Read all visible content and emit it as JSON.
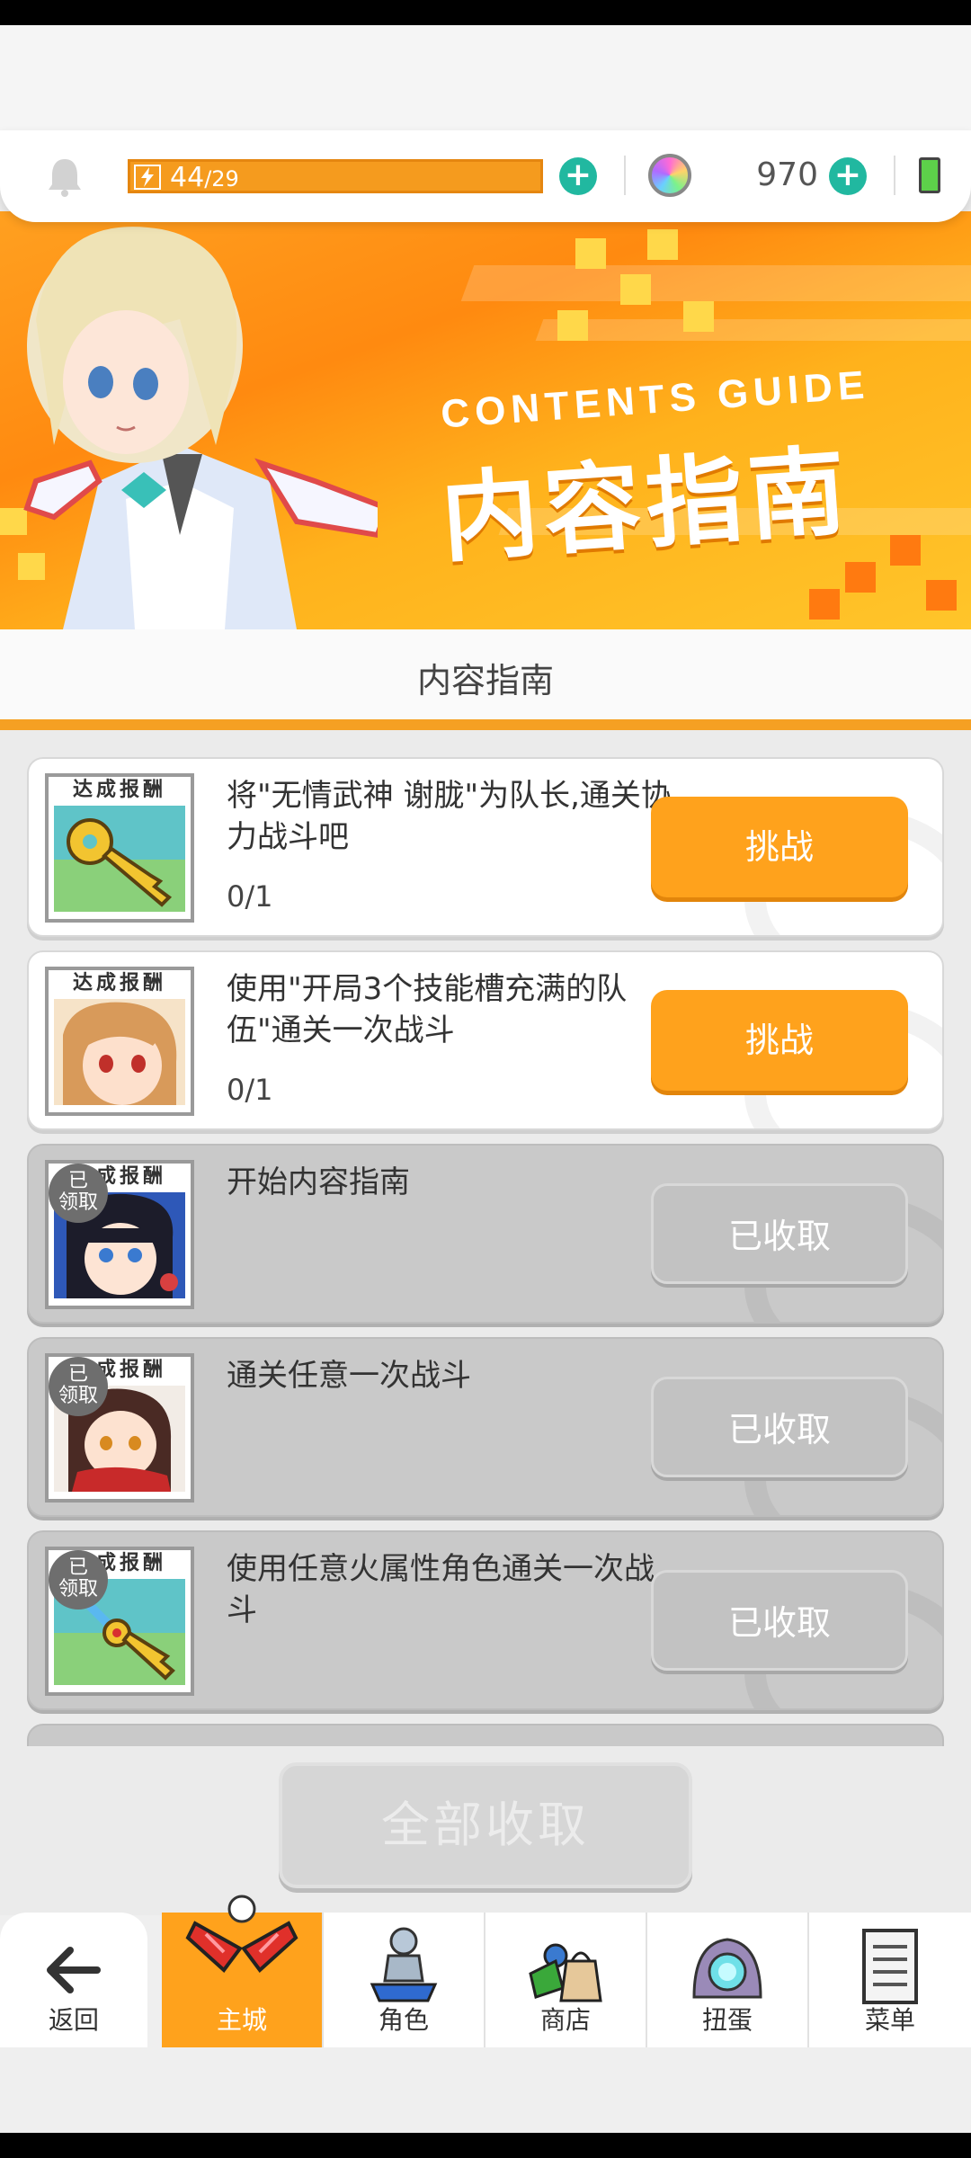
{
  "header": {
    "stamina_current": "44",
    "stamina_max": "/29",
    "gems": "970"
  },
  "banner": {
    "subtitle": "CONTENTS GUIDE",
    "title": "内容指南"
  },
  "section_title": "内容指南",
  "thumb_caption": "达成报酬",
  "claimed_badge": "已\n领取",
  "quests": [
    {
      "text": "将\"无情武神 谢胧\"为队长,通关协力战斗吧",
      "progress": "0/1",
      "button": "挑战",
      "state": "available"
    },
    {
      "text": "使用\"开局3个技能槽充满的队伍\"通关一次战斗",
      "progress": "0/1",
      "button": "挑战",
      "state": "available"
    },
    {
      "text": "开始内容指南",
      "progress": "",
      "button": "已收取",
      "state": "claimed"
    },
    {
      "text": "通关任意一次战斗",
      "progress": "",
      "button": "已收取",
      "state": "claimed"
    },
    {
      "text": "使用任意火属性角色通关一次战斗",
      "progress": "",
      "button": "已收取",
      "state": "claimed"
    }
  ],
  "collect_all": "全部收取",
  "nav": {
    "back": "返回",
    "items": [
      {
        "label": "主城",
        "icon": "castle-icon",
        "active": true
      },
      {
        "label": "角色",
        "icon": "character-icon",
        "active": false
      },
      {
        "label": "商店",
        "icon": "shop-icon",
        "active": false
      },
      {
        "label": "扭蛋",
        "icon": "gacha-icon",
        "active": false
      },
      {
        "label": "菜单",
        "icon": "menu-icon",
        "active": false
      }
    ]
  },
  "colors": {
    "accent": "#ffa21c",
    "teal": "#21b8a0",
    "claimed_bg": "#c9c9c9"
  }
}
